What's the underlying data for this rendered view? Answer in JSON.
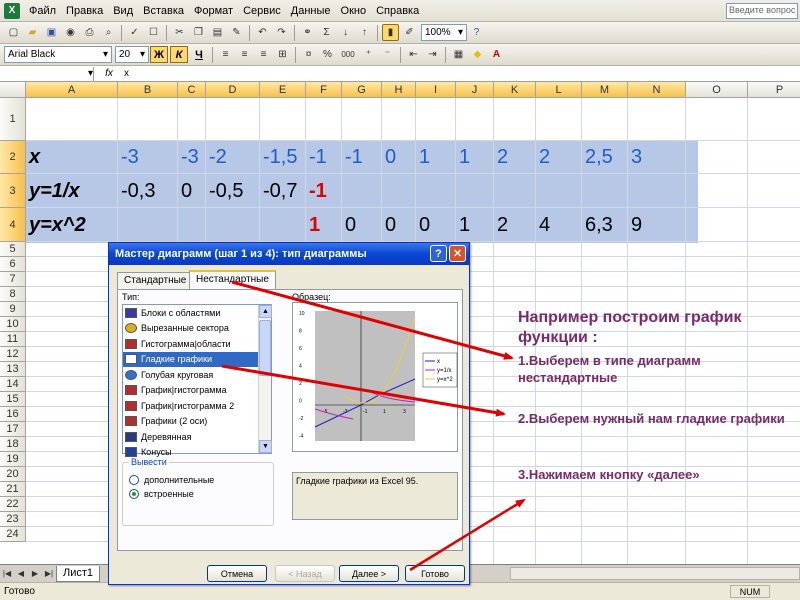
{
  "menu": {
    "items": [
      "Файл",
      "Правка",
      "Вид",
      "Вставка",
      "Формат",
      "Сервис",
      "Данные",
      "Окно",
      "Справка"
    ],
    "help_placeholder": "Введите вопрос"
  },
  "toolbar": {
    "zoom": "100%",
    "font_name": "Arial Black",
    "font_size": "20",
    "bold": "Ж",
    "italic": "К",
    "underline": "Ч",
    "percent": "%",
    "thousands": "000",
    "sigma": "Σ"
  },
  "formula_bar": {
    "fx": "fx",
    "content": "x",
    "name_box": ""
  },
  "columns": [
    "A",
    "B",
    "C",
    "D",
    "E",
    "F",
    "G",
    "H",
    "I",
    "J",
    "K",
    "L",
    "M",
    "N",
    "O",
    "P"
  ],
  "rows": [
    "1",
    "2",
    "3",
    "4",
    "5",
    "6",
    "7",
    "8",
    "9",
    "10",
    "11",
    "12",
    "13",
    "14",
    "15",
    "16",
    "17",
    "18",
    "19",
    "20",
    "21",
    "22",
    "23",
    "24"
  ],
  "table": {
    "row2": {
      "label": "x",
      "values": [
        "-3",
        "-3",
        "-2",
        "-1,5",
        "-1",
        "-1",
        "0",
        "1",
        "1",
        "2",
        "2",
        "2,5",
        "3"
      ]
    },
    "row3": {
      "label": "y=1/x",
      "values": [
        "-0,3",
        "0",
        "-0,5",
        "-0,7",
        "-1"
      ]
    },
    "row4": {
      "label": "y=x^2",
      "values": [
        "1",
        "0",
        "0",
        "0",
        "1",
        "2",
        "4",
        "6,3",
        "9"
      ]
    }
  },
  "sheet": {
    "tab": "Лист1",
    "status": "Готово",
    "num": "NUM"
  },
  "dialog": {
    "title": "Мастер диаграмм (шаг 1 из 4): тип диаграммы",
    "tabs": [
      "Стандартные",
      "Нестандартные"
    ],
    "type_label": "Тип:",
    "sample_label": "Образец:",
    "types": [
      "Блоки с областями",
      "Вырезанные сектора",
      "Гистограмма|области",
      "Гладкие графики",
      "Голубая круговая",
      "График|гистограмма",
      "График|гистограмма 2",
      "Графики (2 оси)",
      "Деревянная",
      "Конусы"
    ],
    "selected_type": "Гладкие графики",
    "output_label": "Вывести",
    "radio_additional": "дополнительные",
    "radio_builtin": "встроенные",
    "description": "Гладкие графики из Excel 95.",
    "buttons": {
      "cancel": "Отмена",
      "back": "< Назад",
      "next": "Далее >",
      "finish": "Готово"
    },
    "preview_legend": [
      "x",
      "y=1/x",
      "y=x^2"
    ],
    "preview_y_ticks": [
      "10",
      "8",
      "6",
      "4",
      "2",
      "0",
      "-2",
      "-4"
    ],
    "preview_x_ticks": [
      "-5",
      "-3",
      "-1",
      "1",
      "3"
    ]
  },
  "annotations": {
    "heading": "Например построим график функции :",
    "step1": "1.Выберем в типе диаграмм нестандартные",
    "step2": "2.Выберем нужный нам гладкие графики",
    "step3": "3.Нажимаем кнопку «далее»"
  },
  "colors": {
    "selection": "#b6c8e6",
    "cell_blue": "#1f5cc6",
    "cell_red": "#e00000",
    "annotation": "#7a2a6a",
    "arrow": "#e00000"
  }
}
